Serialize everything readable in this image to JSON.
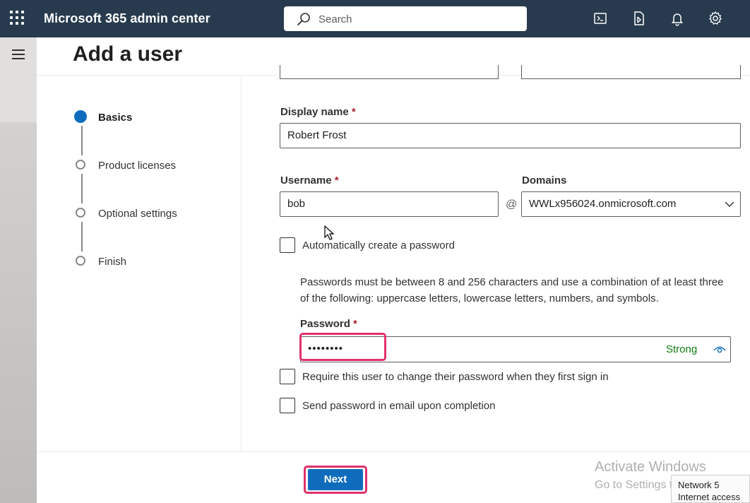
{
  "topbar": {
    "app_title": "Microsoft 365 admin center",
    "search_placeholder": "Search",
    "icons": [
      "waffle-icon",
      "search-icon",
      "terminal-icon",
      "mobile-app-icon",
      "notification-bell-icon",
      "settings-gear-icon"
    ]
  },
  "page": {
    "title": "Add a user"
  },
  "steps": [
    {
      "label": "Basics",
      "active": true
    },
    {
      "label": "Product licenses",
      "active": false
    },
    {
      "label": "Optional settings",
      "active": false
    },
    {
      "label": "Finish",
      "active": false
    }
  ],
  "form": {
    "display_name": {
      "label": "Display name",
      "required_mark": "*",
      "value": "Robert Frost"
    },
    "username": {
      "label": "Username",
      "required_mark": "*",
      "value": "bob"
    },
    "at_symbol": "@",
    "domains": {
      "label": "Domains",
      "value": "WWLx956024.onmicrosoft.com"
    },
    "auto_password": {
      "label": "Automatically create a password",
      "checked": false
    },
    "password_help": "Passwords must be between 8 and 256 characters and use a combination of at least three of the following: uppercase letters, lowercase letters, numbers, and symbols.",
    "password": {
      "label": "Password",
      "required_mark": "*",
      "masked_value": "••••••••",
      "strength": "Strong"
    },
    "require_change": {
      "label": "Require this user to change their password when they first sign in",
      "checked": false
    },
    "send_email": {
      "label": "Send password in email upon completion",
      "checked": false
    }
  },
  "footer": {
    "next_label": "Next"
  },
  "overlay": {
    "activate_title": "Activate Windows",
    "activate_sub": "Go to Settings to activate Windows.",
    "network_line1": "Network 5",
    "network_line2": "Internet access"
  },
  "colors": {
    "topbar": "#283b4e",
    "accent": "#0f6cbd",
    "highlight": "#e0316c",
    "strength": "#107c10"
  }
}
